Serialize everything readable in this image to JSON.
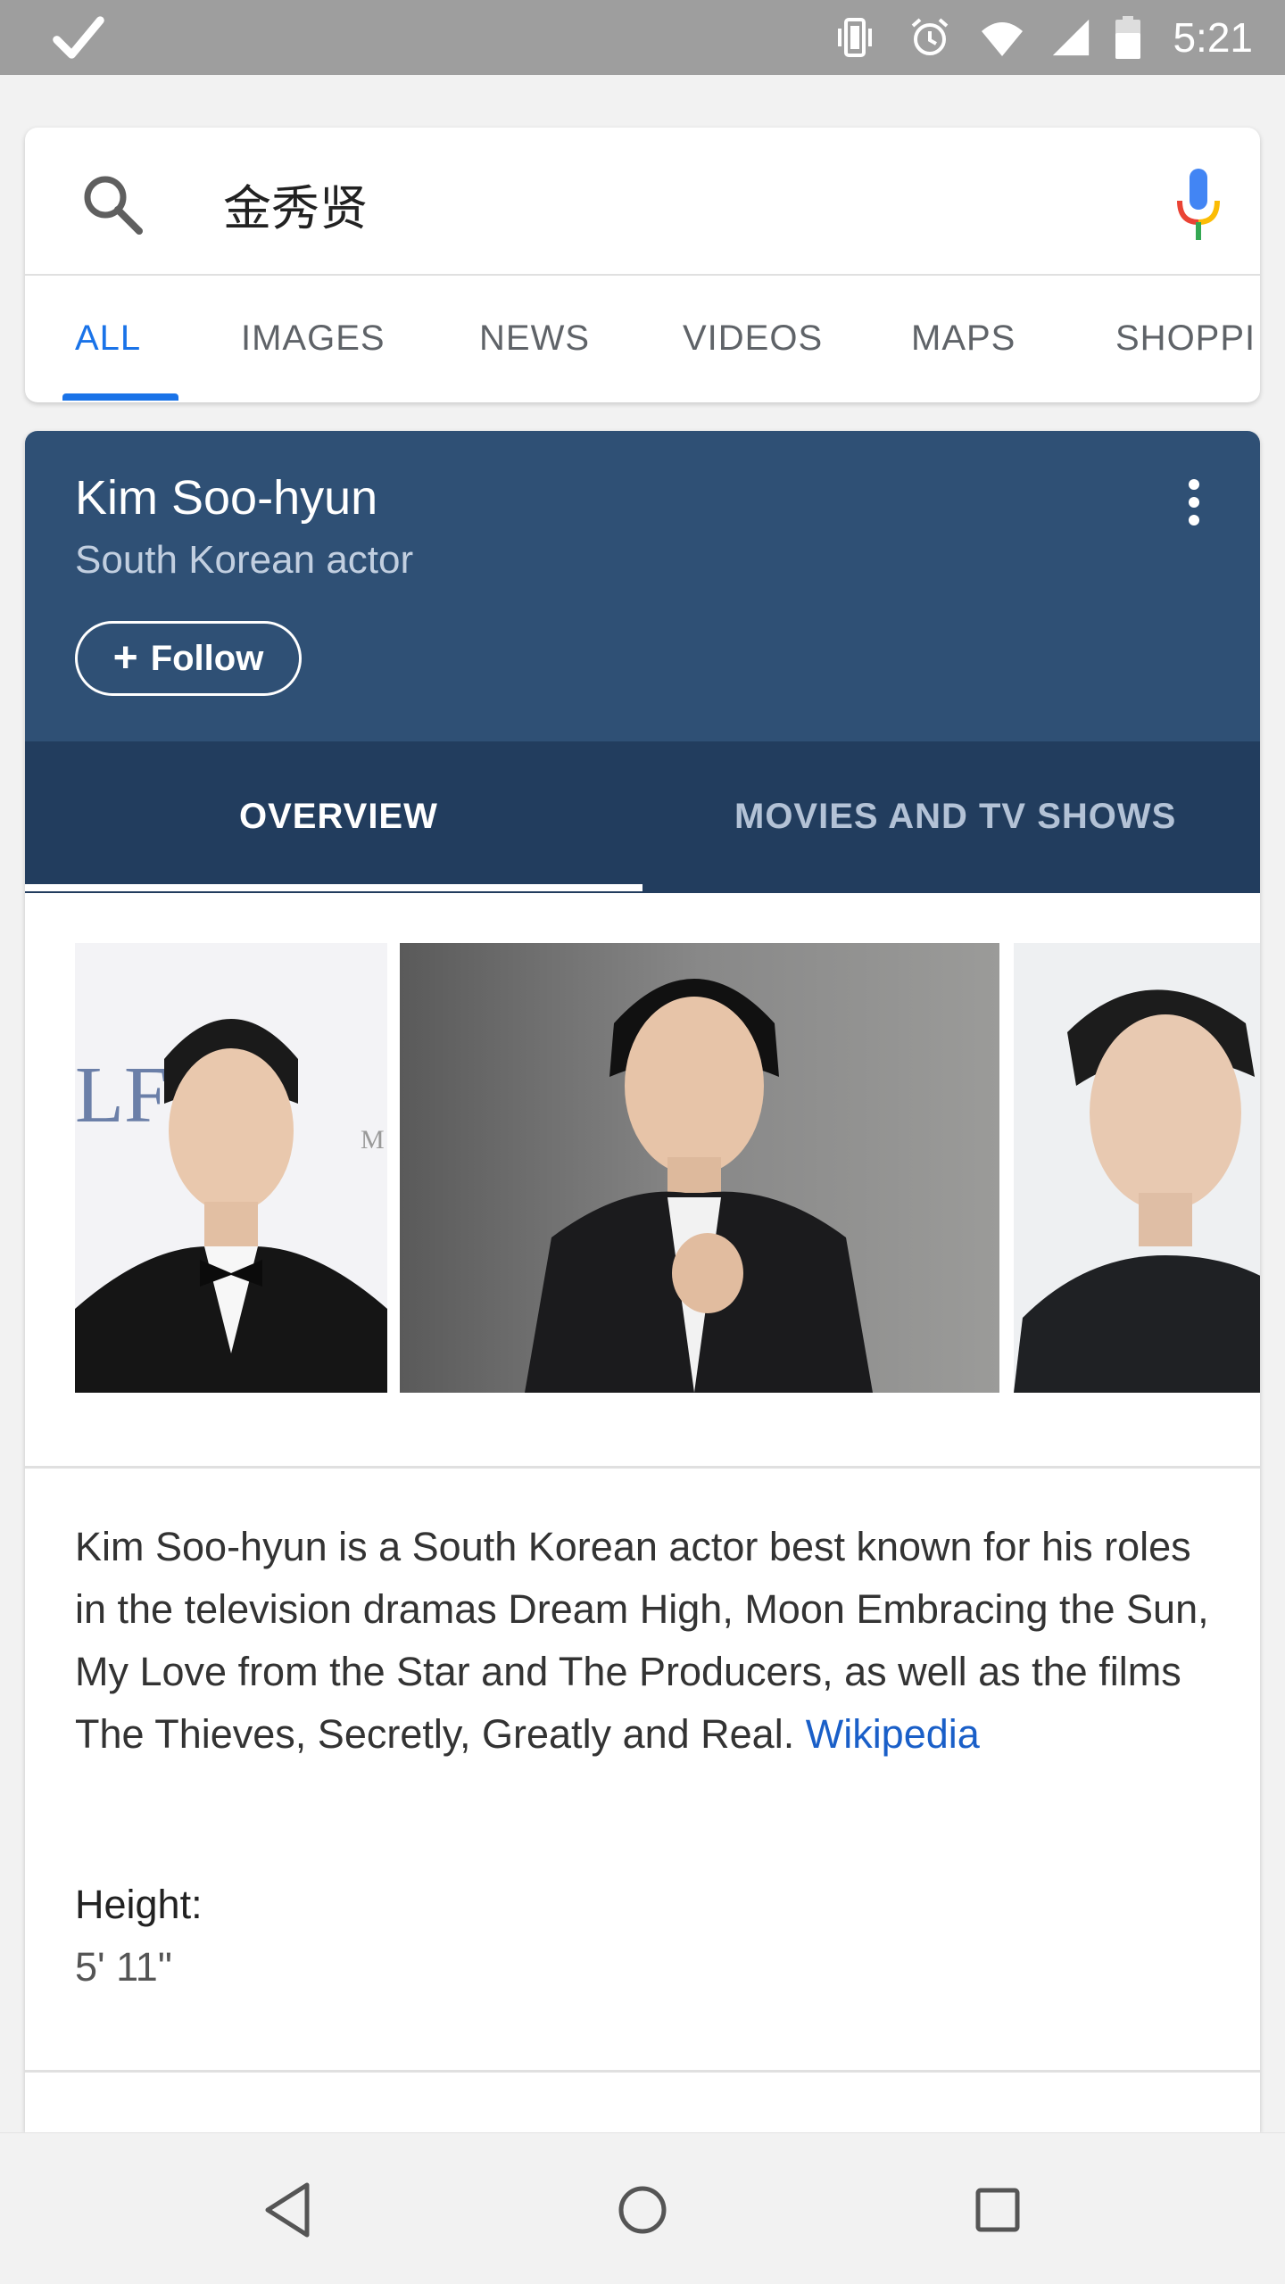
{
  "status_bar": {
    "time": "5:21",
    "icons": [
      "check-icon",
      "vibrate-icon",
      "alarm-icon",
      "wifi-icon",
      "signal-icon",
      "battery-icon"
    ]
  },
  "search": {
    "query": "金秀贤",
    "icons": [
      "search-icon",
      "mic-icon"
    ]
  },
  "tabs": [
    {
      "label": "ALL",
      "active": true
    },
    {
      "label": "IMAGES",
      "active": false
    },
    {
      "label": "NEWS",
      "active": false
    },
    {
      "label": "VIDEOS",
      "active": false
    },
    {
      "label": "MAPS",
      "active": false
    },
    {
      "label": "SHOPPI",
      "active": false
    }
  ],
  "knowledge_panel": {
    "title": "Kim Soo-hyun",
    "subtitle": "South Korean actor",
    "follow_label": "Follow",
    "tabs": [
      {
        "label": "OVERVIEW",
        "active": true
      },
      {
        "label": "MOVIES AND TV SHOWS",
        "active": false
      }
    ],
    "images": [
      {
        "name": "photo-red-carpet-tuxedo"
      },
      {
        "name": "photo-suit-grey-background"
      },
      {
        "name": "photo-dark-jacket-white-background"
      }
    ],
    "description": "Kim Soo-hyun is a South Korean actor best known for his roles in the television dramas Dream High, Moon Embracing the Sun, My Love from the Star and The Producers, as well as the films The Thieves, Secretly, Greatly and Real.",
    "source_link": "Wikipedia",
    "facts": [
      {
        "label": "Height:",
        "value": "5' 11\""
      }
    ]
  },
  "colors": {
    "header_blue": "#2f5075",
    "tabs_dark_blue": "#223d5e",
    "accent_blue": "#1a73e8",
    "link_blue": "#1a5fc8",
    "status_bar_grey": "#9e9e9e"
  },
  "nav_bar": {
    "buttons": [
      "back-icon",
      "home-icon",
      "recents-icon"
    ]
  }
}
